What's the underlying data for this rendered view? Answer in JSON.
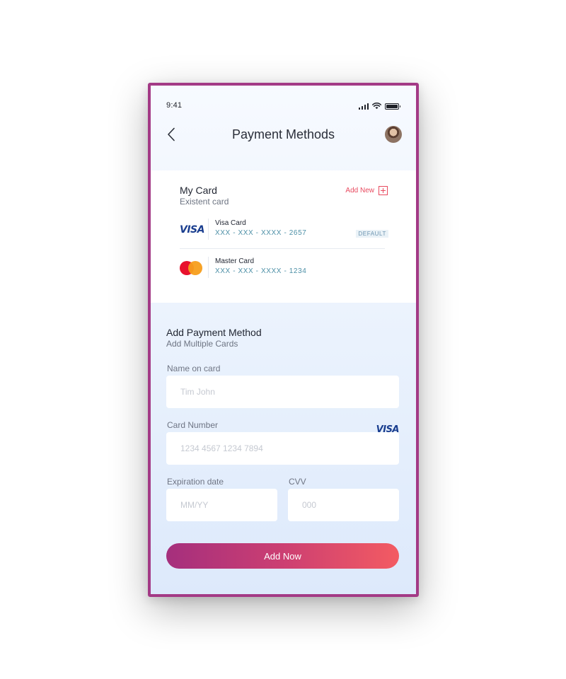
{
  "status_bar": {
    "time": "9:41"
  },
  "header": {
    "title": "Payment Methods"
  },
  "my_card": {
    "title": "My Card",
    "subtitle": "Existent card",
    "add_new_label": "Add New",
    "cards": [
      {
        "brand_icon": "visa-logo",
        "brand_text": "VISA",
        "name": "Visa Card",
        "number": "XXX - XXX - XXXX - 2657",
        "badge": "DEFAULT"
      },
      {
        "brand_icon": "mastercard-logo",
        "name": "Master Card",
        "number": "XXX - XXX - XXXX - 1234",
        "badge": ""
      }
    ]
  },
  "add_payment": {
    "title": "Add Payment Method",
    "subtitle": "Add Multiple Cards",
    "name_label": "Name on card",
    "name_placeholder": "Tim John",
    "number_label": "Card Number",
    "number_placeholder": "1234 4567 1234 7894",
    "number_brand": "VISA",
    "expiry_label": "Expiration date",
    "expiry_placeholder": "MM/YY",
    "cvv_label": "CVV",
    "cvv_placeholder": "000",
    "submit_label": "Add Now"
  },
  "colors": {
    "frame": "#a33a86",
    "accent": "#e84a5f",
    "button_gradient_start": "#a52f7d",
    "button_gradient_end": "#f35b62",
    "card_number": "#4c8fa6",
    "visa_blue": "#1a3e8f"
  }
}
